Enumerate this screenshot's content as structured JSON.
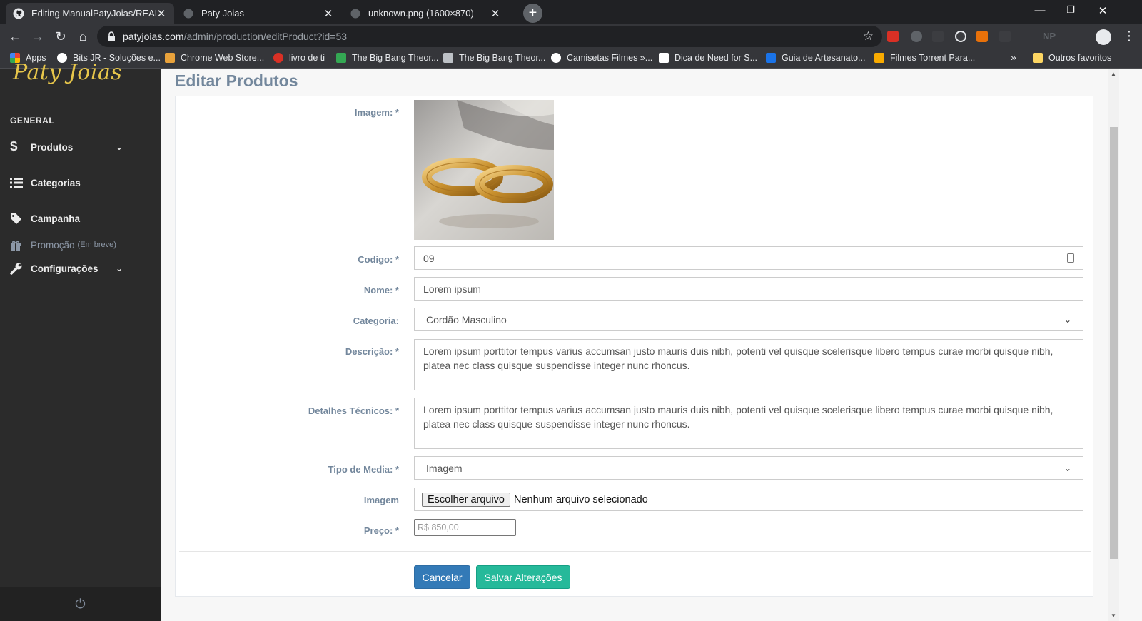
{
  "browser": {
    "tabs": [
      {
        "title": "Editing ManualPatyJoias/READMI",
        "icon": "github-icon",
        "active": true
      },
      {
        "title": "Paty Joias",
        "icon": "globe-icon",
        "active": false
      },
      {
        "title": "unknown.png (1600×870)",
        "icon": "globe-icon",
        "active": false
      }
    ],
    "url_host": "patyjoias.com",
    "url_path": "/admin/production/editProduct?id=53",
    "profile_initials": "NP",
    "bookmarks": [
      {
        "label": "Apps",
        "color": "#4285f4"
      },
      {
        "label": "Bits JR - Soluções e...",
        "color": "#ffffff"
      },
      {
        "label": "Chrome Web Store...",
        "color": "#e9a23b"
      },
      {
        "label": "livro de ti",
        "color": "#d93025"
      },
      {
        "label": "The Big Bang Theor...",
        "color": "#34a853"
      },
      {
        "label": "The Big Bang Theor...",
        "color": "#bdc1c6"
      },
      {
        "label": "Camisetas Filmes »...",
        "color": "#ffffff"
      },
      {
        "label": "Dica de Need for S...",
        "color": "#ffffff"
      },
      {
        "label": "Guia de Artesanato...",
        "color": "#1a73e8"
      },
      {
        "label": "Filmes Torrent Para...",
        "color": "#f9ab00"
      }
    ],
    "more_bookmarks": "»",
    "other_bookmarks": "Outros favoritos"
  },
  "sidebar": {
    "logo": "Paty Joias",
    "section_title": "GENERAL",
    "items": [
      {
        "label": "Produtos",
        "icon": "dollar-icon",
        "has_children": true
      },
      {
        "label": "Categorias",
        "icon": "list-icon",
        "has_children": false
      },
      {
        "label": "Campanha",
        "icon": "tag-icon",
        "has_children": false
      },
      {
        "label": "Promoção",
        "sublabel": "(Em breve)",
        "icon": "gift-icon",
        "disabled": true
      },
      {
        "label": "Configurações",
        "icon": "wrench-icon",
        "has_children": true
      }
    ]
  },
  "page": {
    "title": "Editar Produtos",
    "form": {
      "image_label": "Imagem: *",
      "code_label": "Codigo: *",
      "code_value": "09",
      "name_label": "Nome: *",
      "name_value": "Lorem ipsum",
      "category_label": "Categoria:",
      "category_value": "Cordão Masculino",
      "description_label": "Descrição: *",
      "description_value": "Lorem ipsum porttitor tempus varius accumsan justo mauris duis nibh, potenti vel quisque scelerisque libero tempus curae morbi quisque nibh, platea nec class quisque suspendisse integer nunc rhoncus.",
      "tech_label": "Detalhes Técnicos: *",
      "tech_value": "Lorem ipsum porttitor tempus varius accumsan justo mauris duis nibh, potenti vel quisque scelerisque libero tempus curae morbi quisque nibh, platea nec class quisque suspendisse integer nunc rhoncus.",
      "media_label": "Tipo de Media: *",
      "media_value": "Imagem",
      "file_label": "Imagem",
      "file_button": "Escolher arquivo",
      "file_status": "Nenhum arquivo selecionado",
      "price_label": "Preço: *",
      "price_placeholder": "R$ 850,00"
    },
    "buttons": {
      "cancel": "Cancelar",
      "save": "Salvar Alterações"
    }
  },
  "colors": {
    "sidebar_bg": "#2b2b2b",
    "logo": "#e6c54a",
    "cancel_btn": "#337ab7",
    "save_btn": "#26b99a",
    "label_text": "#73879c"
  }
}
